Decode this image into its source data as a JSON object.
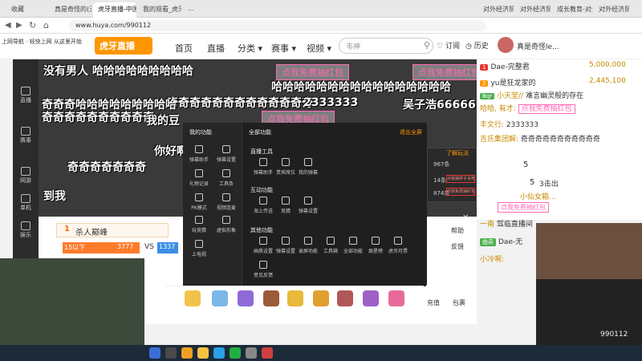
{
  "browser": {
    "tabs": [
      {
        "label": "收藏",
        "active": false
      },
      {
        "label": "真是奇怪的(无)...",
        "active": false
      },
      {
        "label": "虎牙直播-中国领先...",
        "active": true
      },
      {
        "label": "我的观看_虎牙...",
        "active": false
      },
      {
        "label": "...",
        "active": false
      },
      {
        "label": "对外经济贸易大学",
        "active": false
      },
      {
        "label": "对外经济贸易大学",
        "active": false
      },
      {
        "label": "成长教育-对外经...",
        "active": false
      },
      {
        "label": "对外经济贸易大",
        "active": false
      }
    ],
    "url": "www.huya.com/990112",
    "bookmark": "上网导航 · 轻快上网 从这里开始"
  },
  "header": {
    "logo": "虎牙直播",
    "logo_sub": "huya.com",
    "nav": [
      "首页",
      "直播",
      "分类 ▾",
      "赛事 ▾",
      "视频 ▾"
    ],
    "search_placeholder": "韦神",
    "subscribe": "订阅",
    "history": "历史",
    "username": "真是奇怪le..."
  },
  "sidebar": [
    "直播",
    "赛事",
    "网游",
    "单机",
    "娱乐"
  ],
  "video": {
    "danmu": [
      "没有男人 哈哈哈哈哈哈哈哈哈",
      "哈哈哈哈哈哈哈哈哈哈哈哈哈哈哈哈",
      "奇奇奇奇奇奇奇奇奇奇奇奇奇",
      "奇奇奇哈哈哈哈哈哈哈哈哈",
      "奇奇奇奇奇奇奇奇奇奇",
      "2333333",
      "吴子浩66666",
      "我的豆",
      "点我免费抽红包",
      "奇奇奇奇奇奇奇",
      "到我",
      "你好啊"
    ],
    "boxes": [
      "点我免费抽红包",
      "点我免费抽红包",
      "点我免费抽红包"
    ]
  },
  "popup": {
    "left_title": "我的功能",
    "left_items": [
      "弹幕助手",
      "弹幕设置",
      "礼物记录",
      "工具条",
      "PK模式",
      "视频连麦",
      "玩竞猜",
      "虚拟形象",
      "上电视"
    ],
    "right_title": "全部功能",
    "right_action": "退出全屏",
    "sections": [
      {
        "title": "直播工具",
        "items": [
          "弹幕助手",
          "贵宾席位",
          "我的弹幕"
        ]
      },
      {
        "title": "互动功能",
        "items": [
          "海上传送",
          "竞猜",
          "弹幕设置"
        ]
      },
      {
        "title": "其他功能",
        "items": [
          "画质设置",
          "弹幕设置",
          "录屏功能",
          "工具箱",
          "全部功能",
          "周星榜",
          "虎牙月票"
        ]
      },
      {
        "title": "",
        "items": [
          "意见反馈"
        ]
      }
    ]
  },
  "rank": {
    "title": "杀人巅峰",
    "row_left": "15以下",
    "left_value": "3777",
    "vs": "VS",
    "right_value": "1337"
  },
  "right": {
    "users": [
      {
        "name": "Dae-完整君",
        "value": "5,000,000"
      },
      {
        "name": "yu是狂龙家的",
        "value": "2,445,100"
      }
    ],
    "chats": [
      {
        "badge": "Bqr",
        "user": "小天堂//",
        "text": "难言幽灵般的存在"
      },
      {
        "badge": "",
        "user": "哈哈, 有才:",
        "text": "点我免费抽红包"
      },
      {
        "badge": "",
        "user": "丰文行:",
        "text": "2333333"
      },
      {
        "badge": "",
        "user": "吉氏集团解:",
        "text": "奇奇奇奇奇奇奇奇奇奇奇"
      }
    ],
    "dark_panel": {
      "title": "了解玩法",
      "rows": [
        "967条",
        "14条",
        "874条"
      ],
      "buttons": [
        "点我抽奖子没电表",
        "点我免费抽红包"
      ]
    },
    "count1": "5",
    "count2": "5",
    "fire": "3击出",
    "gift_text": "小仙女箱...",
    "gift_action": "点我免费抽红包",
    "bottom_chats": [
      {
        "user": "一南",
        "text": "驾临直播间"
      },
      {
        "user": "曲奇",
        "text": "Dae-无"
      },
      {
        "user": "",
        "text": "小冷啊:"
      }
    ],
    "toolbox": [
      "帮助",
      "反馈",
      "充值",
      "包裹"
    ]
  },
  "cams": {
    "cam1_text": "",
    "cam2_text": "990112"
  },
  "taskbar": [
    "开始",
    "搜索",
    "浏览器",
    "文件",
    "QQ",
    "微信",
    "设置",
    "录屏"
  ]
}
